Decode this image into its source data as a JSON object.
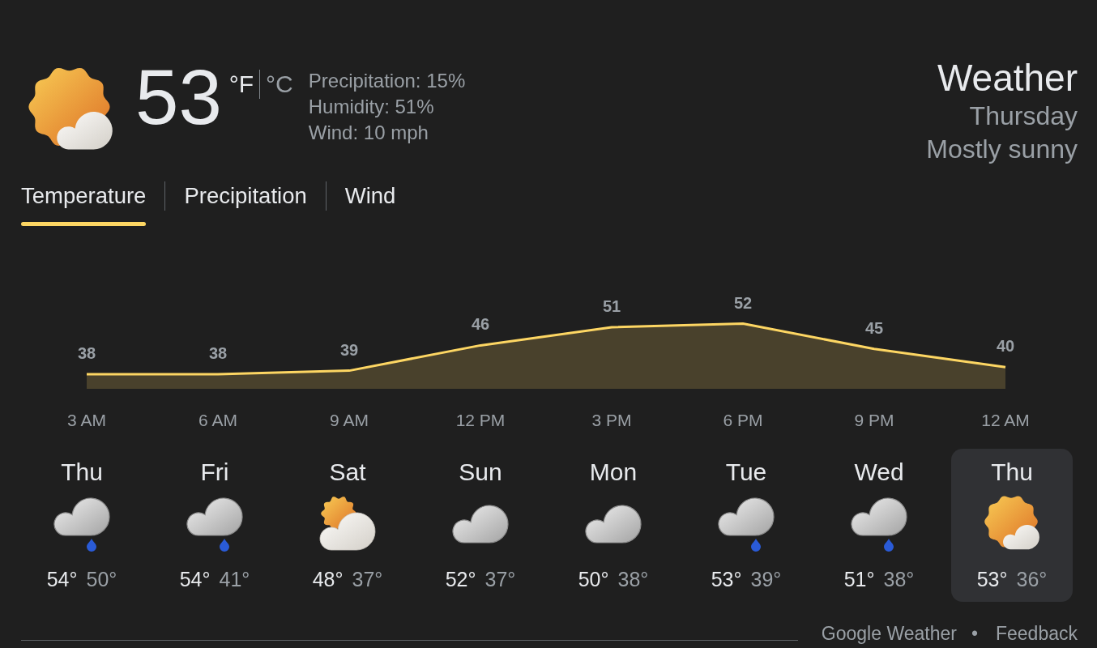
{
  "current": {
    "kind": "mostly_sunny",
    "temperature": "53",
    "units": [
      {
        "label": "°F",
        "selected": true
      },
      {
        "label": "°C",
        "selected": false
      }
    ],
    "details": [
      "Precipitation: 15%",
      "Humidity: 51%",
      "Wind: 10 mph"
    ]
  },
  "header": {
    "title": "Weather",
    "day": "Thursday",
    "condition": "Mostly sunny"
  },
  "tabs": [
    {
      "label": "Temperature",
      "selected": true
    },
    {
      "label": "Precipitation",
      "selected": false
    },
    {
      "label": "Wind",
      "selected": false
    }
  ],
  "chart": {
    "chart_data": {
      "type": "area",
      "categories": [
        "3 AM",
        "6 AM",
        "9 AM",
        "12 PM",
        "3 PM",
        "6 PM",
        "9 PM",
        "12 AM"
      ],
      "values": [
        38,
        38,
        39,
        46,
        51,
        52,
        45,
        40
      ],
      "data_labels": true
    }
  },
  "days": [
    {
      "name": "Thu",
      "kind": "rain",
      "high": "54°",
      "low": "50°",
      "selected": false
    },
    {
      "name": "Fri",
      "kind": "rain",
      "high": "54°",
      "low": "41°",
      "selected": false
    },
    {
      "name": "Sat",
      "kind": "partly_cloudy",
      "high": "48°",
      "low": "37°",
      "selected": false
    },
    {
      "name": "Sun",
      "kind": "cloudy",
      "high": "52°",
      "low": "37°",
      "selected": false
    },
    {
      "name": "Mon",
      "kind": "cloudy",
      "high": "50°",
      "low": "38°",
      "selected": false
    },
    {
      "name": "Tue",
      "kind": "rain",
      "high": "53°",
      "low": "39°",
      "selected": false
    },
    {
      "name": "Wed",
      "kind": "rain",
      "high": "51°",
      "low": "38°",
      "selected": false
    },
    {
      "name": "Thu",
      "kind": "mostly_sunny",
      "high": "53°",
      "low": "36°",
      "selected": true
    }
  ],
  "footer": {
    "links": [
      "Google Weather",
      "Feedback"
    ],
    "separator": "•"
  }
}
